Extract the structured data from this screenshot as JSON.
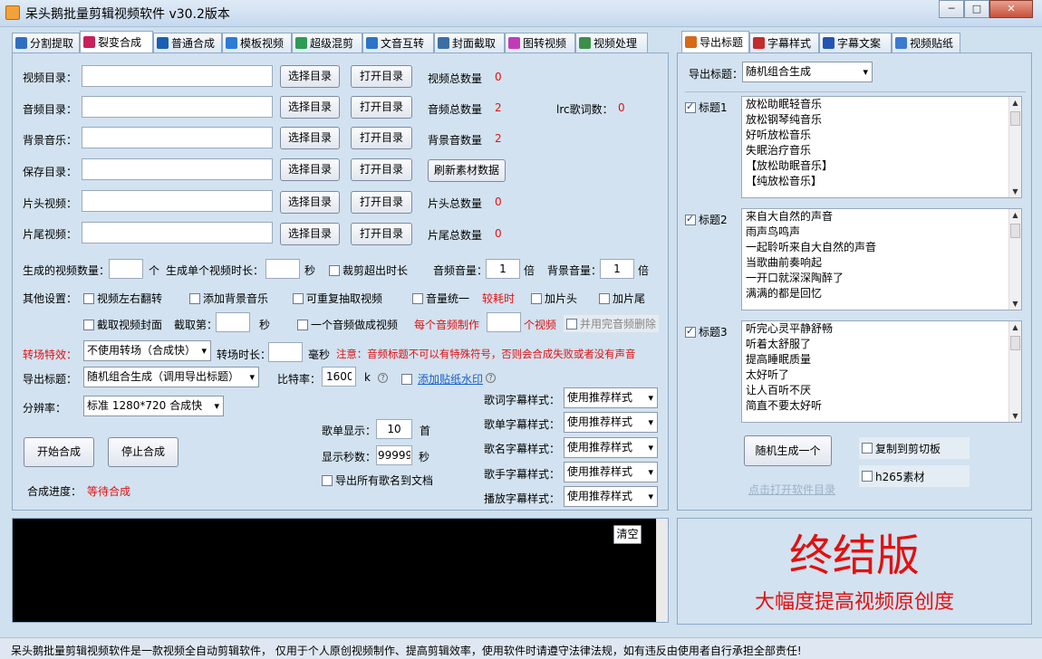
{
  "window": {
    "title": "呆头鹅批量剪辑视频软件  v30.2版本",
    "min": "─",
    "max": "□",
    "close": "✕"
  },
  "tabs": [
    {
      "label": "分割提取",
      "icon": "split-icon",
      "color": "#2f6fc1"
    },
    {
      "label": "裂变合成",
      "icon": "fission-icon",
      "color": "#c8205a"
    },
    {
      "label": "普通合成",
      "icon": "play-icon",
      "color": "#1a5fb4"
    },
    {
      "label": "模板视频",
      "icon": "template-icon",
      "color": "#2d7bd6"
    },
    {
      "label": "超级混剪",
      "icon": "mix-icon",
      "color": "#2e9b55"
    },
    {
      "label": "文音互转",
      "icon": "mic-icon",
      "color": "#2b74c8"
    },
    {
      "label": "封面截取",
      "icon": "picture-icon",
      "color": "#3b6ea5"
    },
    {
      "label": "图转视频",
      "icon": "image-video-icon",
      "color": "#c03bb8"
    },
    {
      "label": "视频处理",
      "icon": "film-icon",
      "color": "#3c8f4a"
    }
  ],
  "right_tabs": [
    {
      "label": "导出标题",
      "icon": "export-title-icon",
      "color": "#d66a17"
    },
    {
      "label": "字幕样式",
      "icon": "subtitle-style-icon",
      "color": "#c22c2c"
    },
    {
      "label": "字幕文案",
      "icon": "subtitle-text-icon",
      "color": "#2356b3"
    },
    {
      "label": "视频贴纸",
      "icon": "sticker-icon",
      "color": "#3a7ad0"
    }
  ],
  "dirs": [
    {
      "label": "视频目录：",
      "value": "",
      "choose": "选择目录",
      "open": "打开目录",
      "count_label": "视频总数量",
      "count": "0"
    },
    {
      "label": "音频目录：",
      "value": "",
      "choose": "选择目录",
      "open": "打开目录",
      "count_label": "音频总数量",
      "count": "2"
    },
    {
      "label": "背景音乐：",
      "value": "",
      "choose": "选择目录",
      "open": "打开目录",
      "count_label": "背景音数量",
      "count": "2"
    },
    {
      "label": "保存目录：",
      "value": "",
      "choose": "选择目录",
      "open": "打开目录"
    },
    {
      "label": "片头视频：",
      "value": "",
      "choose": "选择目录",
      "open": "打开目录",
      "count_label": "片头总数量",
      "count": "0"
    },
    {
      "label": "片尾视频：",
      "value": "",
      "choose": "选择目录",
      "open": "打开目录",
      "count_label": "片尾总数量",
      "count": "0"
    }
  ],
  "refresh_btn": "刷新素材数据",
  "lrc_label": "lrc歌词数：",
  "lrc_count": "0",
  "gen": {
    "count_label": "生成的视频数量：",
    "count_value": "",
    "unit_ge": "个",
    "dur_label": "生成单个视频时长：",
    "dur_value": "",
    "unit_sec": "秒",
    "crop_over": "裁剪超出时长",
    "audio_vol_label": "音频音量：",
    "audio_vol": "1",
    "bei": "倍",
    "bg_vol_label": "背景音量：",
    "bg_vol": "1",
    "bei2": "倍"
  },
  "other": {
    "label": "其他设置：",
    "flip": "视频左右翻转",
    "add_bg": "添加背景音乐",
    "repeat": "可重复抽取视频",
    "vol_unify": "音量统一",
    "slow_note": "较耗时",
    "add_head": "加片头",
    "add_tail": "加片尾"
  },
  "row3": {
    "cover": "截取视频封面",
    "take_label": "截取第：",
    "take_value": "",
    "sec": "秒",
    "one_audio": "一个音频做成视频",
    "per_audio": "每个音频制作",
    "per_value": "",
    "unit_video": "个视频",
    "delete_used": "并用完音频删除"
  },
  "transition": {
    "label": "转场特效：",
    "value": "不使用转场（合成快）",
    "dur_label": "转场时长：",
    "dur_value": "",
    "unit": "毫秒",
    "note": "注意：音频标题不可以有特殊符号，否则会合成失败或者没有声音"
  },
  "export_title": {
    "label": "导出标题：",
    "value": "随机组合生成（调用导出标题）",
    "bitrate_label": "比特率：",
    "bitrate": "1600",
    "k": "k",
    "add_sticker": "添加贴纸水印"
  },
  "resolution": {
    "label": "分辨率：",
    "value": "标准 1280*720 合成快"
  },
  "styles": [
    {
      "label": "歌词字幕样式：",
      "value": "使用推荐样式"
    },
    {
      "label": "歌单字幕样式：",
      "value": "使用推荐样式"
    },
    {
      "label": "歌名字幕样式：",
      "value": "使用推荐样式"
    },
    {
      "label": "歌手字幕样式：",
      "value": "使用推荐样式"
    },
    {
      "label": "播放字幕样式：",
      "value": "使用推荐样式"
    }
  ],
  "songlist": {
    "show_label": "歌单显示：",
    "show_value": "10",
    "unit": "首",
    "sec_label": "显示秒数：",
    "sec_value": "99999",
    "sec_unit": "秒",
    "export_all": "导出所有歌名到文档"
  },
  "actions": {
    "start": "开始合成",
    "stop": "停止合成",
    "progress_label": "合成进度：",
    "progress_value": "等待合成"
  },
  "log": {
    "clear": "清空"
  },
  "right": {
    "export_label": "导出标题：",
    "export_value": "随机组合生成",
    "titles": [
      {
        "label": "标题1",
        "checked": true,
        "lines": [
          "放松助眠轻音乐",
          "放松钢琴纯音乐",
          "好听放松音乐",
          "失眠治疗音乐",
          "【放松助眠音乐】",
          "【纯放松音乐】"
        ]
      },
      {
        "label": "标题2",
        "checked": true,
        "lines": [
          "来自大自然的声音",
          "雨声鸟鸣声",
          "一起聆听来自大自然的声音",
          "当歌曲前奏响起",
          "一开口就深深陶醉了",
          "满满的都是回忆"
        ]
      },
      {
        "label": "标题3",
        "checked": true,
        "lines": [
          "听完心灵平静舒畅",
          "听着太舒服了",
          "提高睡眠质量",
          "太好听了",
          "让人百听不厌",
          "简直不要太好听"
        ]
      }
    ],
    "random_btn": "随机生成一个",
    "copy_clip": "复制到剪切板",
    "h265": "h265素材",
    "open_dir_link": "点击打开软件目录"
  },
  "promo": {
    "title": "终结版",
    "subtitle": "大幅度提高视频原创度"
  },
  "status": "呆头鹅批量剪辑视频软件是一款视频全自动剪辑软件， 仅用于个人原创视频制作、提高剪辑效率，使用软件时请遵守法律法规，如有违反由使用者自行承担全部责任!",
  "colors": {
    "accent_red": "#e21010",
    "panel": "#d2e2f0"
  }
}
